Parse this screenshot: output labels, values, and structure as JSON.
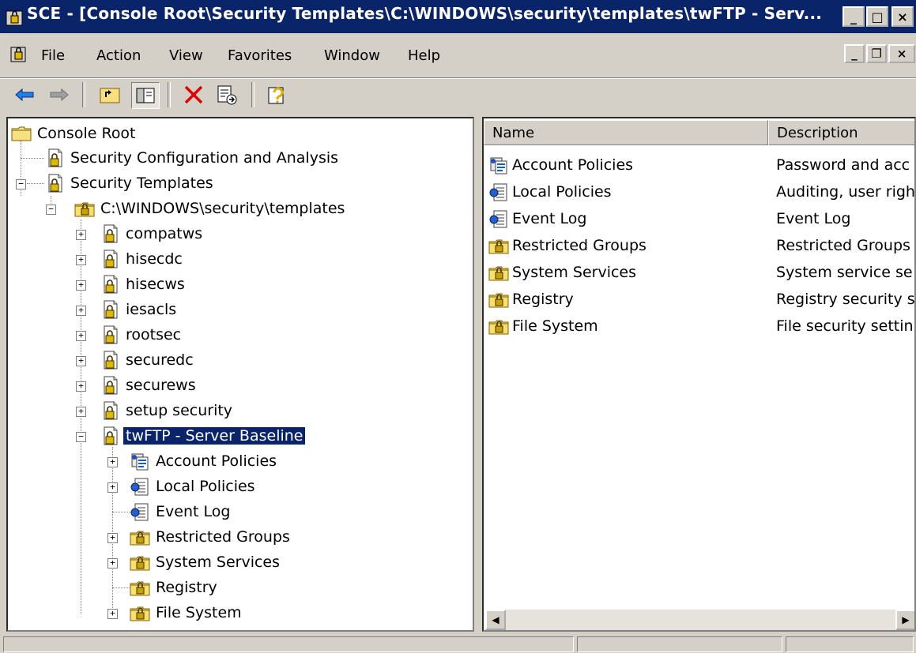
{
  "window": {
    "title": "SCE - [Console Root\\Security Templates\\C:\\WINDOWS\\security\\templates\\twFTP - Serv...",
    "minimize": "_",
    "maximize": "□",
    "close": "×"
  },
  "menu": {
    "file": "File",
    "action": "Action",
    "view": "View",
    "favorites": "Favorites",
    "window": "Window",
    "help": "Help",
    "mdi_min": "_",
    "mdi_restore": "❐",
    "mdi_close": "×"
  },
  "tree": {
    "console_root": "Console Root",
    "sca": "Security Configuration and Analysis",
    "security_templates": "Security Templates",
    "templates_path": "C:\\WINDOWS\\security\\templates",
    "templates": [
      "compatws",
      "hisecdc",
      "hisecws",
      "iesacls",
      "rootsec",
      "securedc",
      "securews",
      "setup security"
    ],
    "selected": "twFTP - Server Baseline",
    "children": [
      "Account Policies",
      "Local Policies",
      "Event Log",
      "Restricted Groups",
      "System Services",
      "Registry",
      "File System"
    ]
  },
  "list": {
    "col_name": "Name",
    "col_desc": "Description",
    "rows": [
      {
        "name": "Account Policies",
        "desc": "Password and acc"
      },
      {
        "name": "Local Policies",
        "desc": "Auditing, user righ"
      },
      {
        "name": "Event Log",
        "desc": "Event Log"
      },
      {
        "name": "Restricted Groups",
        "desc": "Restricted Groups"
      },
      {
        "name": "System Services",
        "desc": "System service se"
      },
      {
        "name": "Registry",
        "desc": "Registry security s"
      },
      {
        "name": "File System",
        "desc": "File security settin"
      }
    ]
  },
  "colors": {
    "titlebar": "#0a246a",
    "face": "#d4d0c8",
    "selection": "#0a246a"
  }
}
